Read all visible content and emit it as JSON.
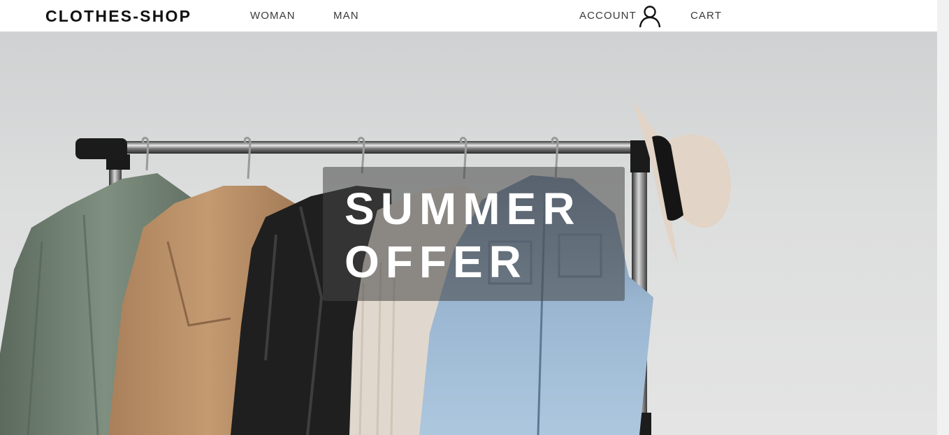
{
  "nav": {
    "brand": "CLOTHES-SHOP",
    "links": [
      {
        "label": "WOMAN"
      },
      {
        "label": "MAN"
      }
    ],
    "account_label": "ACCOUNT",
    "cart_label": "CART"
  },
  "hero": {
    "title": "SUMMER\nOFFER"
  },
  "colors": {
    "nav_background": "#ffffff",
    "text_dark": "#111111",
    "hero_background": "#dcdddd",
    "offer_overlay": "#464646",
    "offer_text": "#ffffff"
  },
  "icons": {
    "account": "user-icon"
  }
}
